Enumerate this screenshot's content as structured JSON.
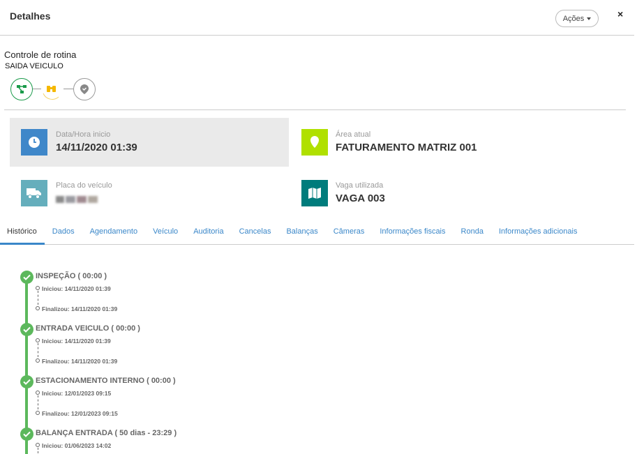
{
  "header": {
    "title": "Detalhes",
    "actions_label": "Ações",
    "close_label": "×"
  },
  "routine": {
    "title": "Controle de rotina",
    "subtitle": "SAIDA VEICULO",
    "steps": [
      {
        "icon": "flow-icon",
        "color": "#1a9a4a",
        "state": "done"
      },
      {
        "icon": "binoculars-icon",
        "color": "#f5b800",
        "state": "current"
      },
      {
        "icon": "location-check-icon",
        "color": "#888888",
        "state": "pending"
      }
    ]
  },
  "info": [
    {
      "label": "Data/Hora inicio",
      "value": "14/11/2020 01:39",
      "icon": "clock-icon",
      "color": "#3f87c9"
    },
    {
      "label": "Área atual",
      "value": "FATURAMENTO MATRIZ 001",
      "icon": "map-marker-icon",
      "color": "#b0e000"
    },
    {
      "label": "Placa do veículo",
      "value": null,
      "icon": "truck-icon",
      "color": "#65aebc"
    },
    {
      "label": "Vaga utilizada",
      "value": "VAGA 003",
      "icon": "map-icon",
      "color": "#007c7c"
    }
  ],
  "tabs": [
    "Histórico",
    "Dados",
    "Agendamento",
    "Veículo",
    "Auditoria",
    "Cancelas",
    "Balanças",
    "Câmeras",
    "Informações fiscais",
    "Ronda",
    "Informações adicionais"
  ],
  "active_tab": "Histórico",
  "history": [
    {
      "title": "INSPEÇÃO ( 00:00 )",
      "start": "Iniciou: 14/11/2020 01:39",
      "end": "Finalizou: 14/11/2020 01:39"
    },
    {
      "title": "ENTRADA VEICULO ( 00:00 )",
      "start": "Iniciou: 14/11/2020 01:39",
      "end": "Finalizou: 14/11/2020 01:39"
    },
    {
      "title": "ESTACIONAMENTO INTERNO ( 00:00 )",
      "start": "Iniciou: 12/01/2023 09:15",
      "end": "Finalizou: 12/01/2023 09:15"
    },
    {
      "title": "BALANÇA ENTRADA ( 50 dias - 23:29 )",
      "start": "Iniciou: 01/06/2023 14:02"
    }
  ]
}
